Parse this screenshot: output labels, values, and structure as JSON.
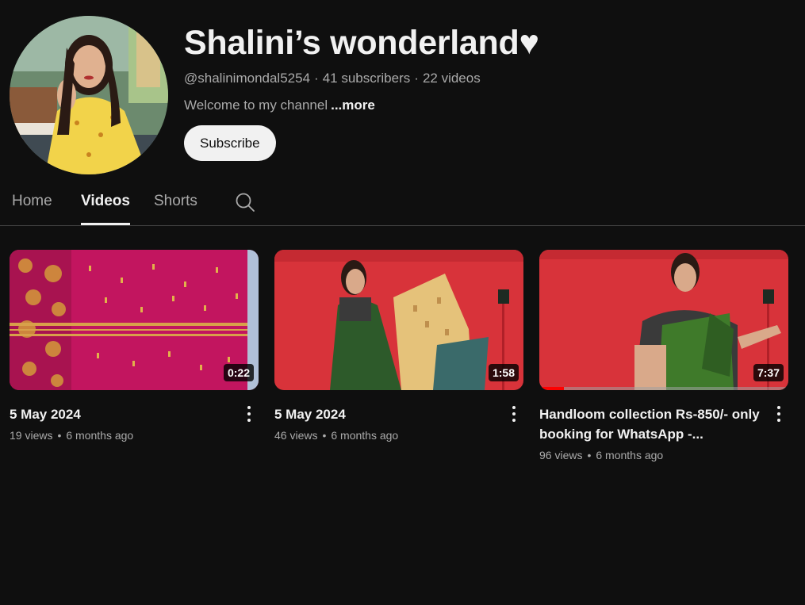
{
  "channel": {
    "name": "Shalini’s wonderland♥",
    "handle": "@shalinimondal5254",
    "subscribers": "41 subscribers",
    "video_count": "22 videos",
    "description": "Welcome to my channel",
    "more_label": "...more",
    "subscribe_label": "Subscribe"
  },
  "tabs": [
    {
      "label": "Home",
      "active": false
    },
    {
      "label": "Videos",
      "active": true
    },
    {
      "label": "Shorts",
      "active": false
    }
  ],
  "videos": [
    {
      "title": "5 May 2024",
      "views": "19 views",
      "age": "6 months ago",
      "duration": "0:22"
    },
    {
      "title": "5 May 2024",
      "views": "46 views",
      "age": "6 months ago",
      "duration": "1:58"
    },
    {
      "title": "Handloom collection Rs-850/- only booking for WhatsApp -...",
      "views": "96 views",
      "age": "6 months ago",
      "duration": "7:37",
      "watched_fraction": 0.1
    }
  ],
  "colors": {
    "background": "#0f0f0f",
    "accent": "#ff0000",
    "subscribe_bg": "#f1f1f1"
  }
}
